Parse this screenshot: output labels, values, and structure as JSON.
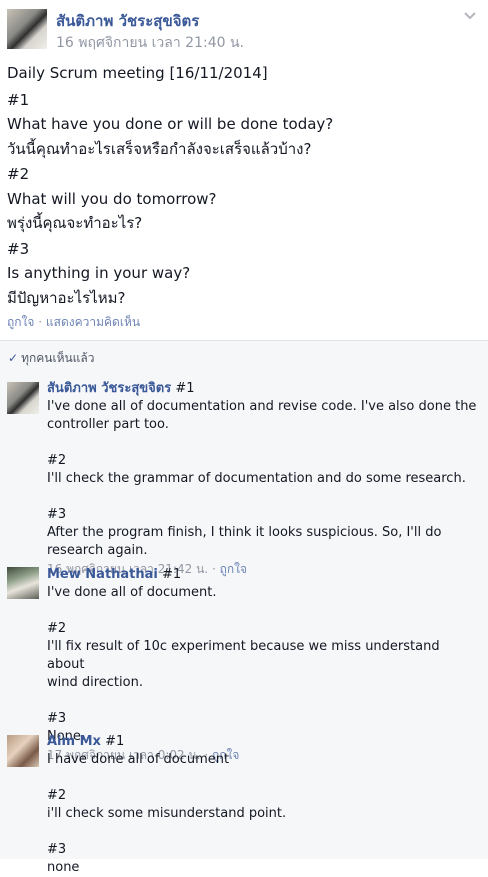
{
  "post": {
    "author": "สันติภาพ วัชระสุขจิตร",
    "timestamp": "16 พฤศจิกายน เวลา 21:40 น.",
    "lines": [
      "Daily Scrum meeting [16/11/2014]",
      "#1",
      "What have you done or will be done today?",
      "วันนี้คุณทำอะไรเสร็จหรือกำลังจะเสร็จแล้วบ้าง?",
      "#2",
      "What will you do tomorrow?",
      "พรุ่งนี้คุณจะทำอะไร?",
      "#3",
      "Is anything in your way?",
      "มีปัญหาอะไรไหม?"
    ],
    "actions": {
      "like": "ถูกใจ",
      "separator": "·",
      "comment": "แสดงความคิดเห็น"
    }
  },
  "seen": {
    "label": "ทุกคนเห็นแล้ว"
  },
  "comments": [
    {
      "author": "สันติภาพ วัชระสุขจิตร",
      "first": "#1",
      "lines": [
        "I've done all of documentation and revise code. I've also done the",
        "controller part too.",
        "",
        "#2",
        "I'll check the grammar of documentation and do some research.",
        "",
        "#3",
        "After the program finish, I think it looks suspicious. So, I'll do",
        "research again."
      ],
      "time": "16 พฤศจิกายน เวลา 21:42 น.",
      "like": "ถูกใจ"
    },
    {
      "author": "Mew Nathathai",
      "first": "#1",
      "lines": [
        "I've done all of document.",
        "",
        "#2",
        "I'll fix result of 10c experiment because we miss understand about",
        "wind direction.",
        "",
        "#3",
        "None."
      ],
      "time": "17 พฤศจิกายน เวลา 0:02 น.",
      "like": "ถูกใจ"
    },
    {
      "author": "Aim Mx",
      "first": "#1",
      "lines": [
        "I have done all of document",
        "",
        "#2",
        "i'll check some misunderstand point.",
        "",
        "#3",
        "none"
      ]
    }
  ],
  "colors": {
    "link": "#3b5998",
    "meta": "#9197a3",
    "action": "#6d84b4",
    "comment_bg": "#f6f7f9"
  },
  "icons": {
    "chevron": "chevron-down-icon",
    "check": "check-icon"
  }
}
